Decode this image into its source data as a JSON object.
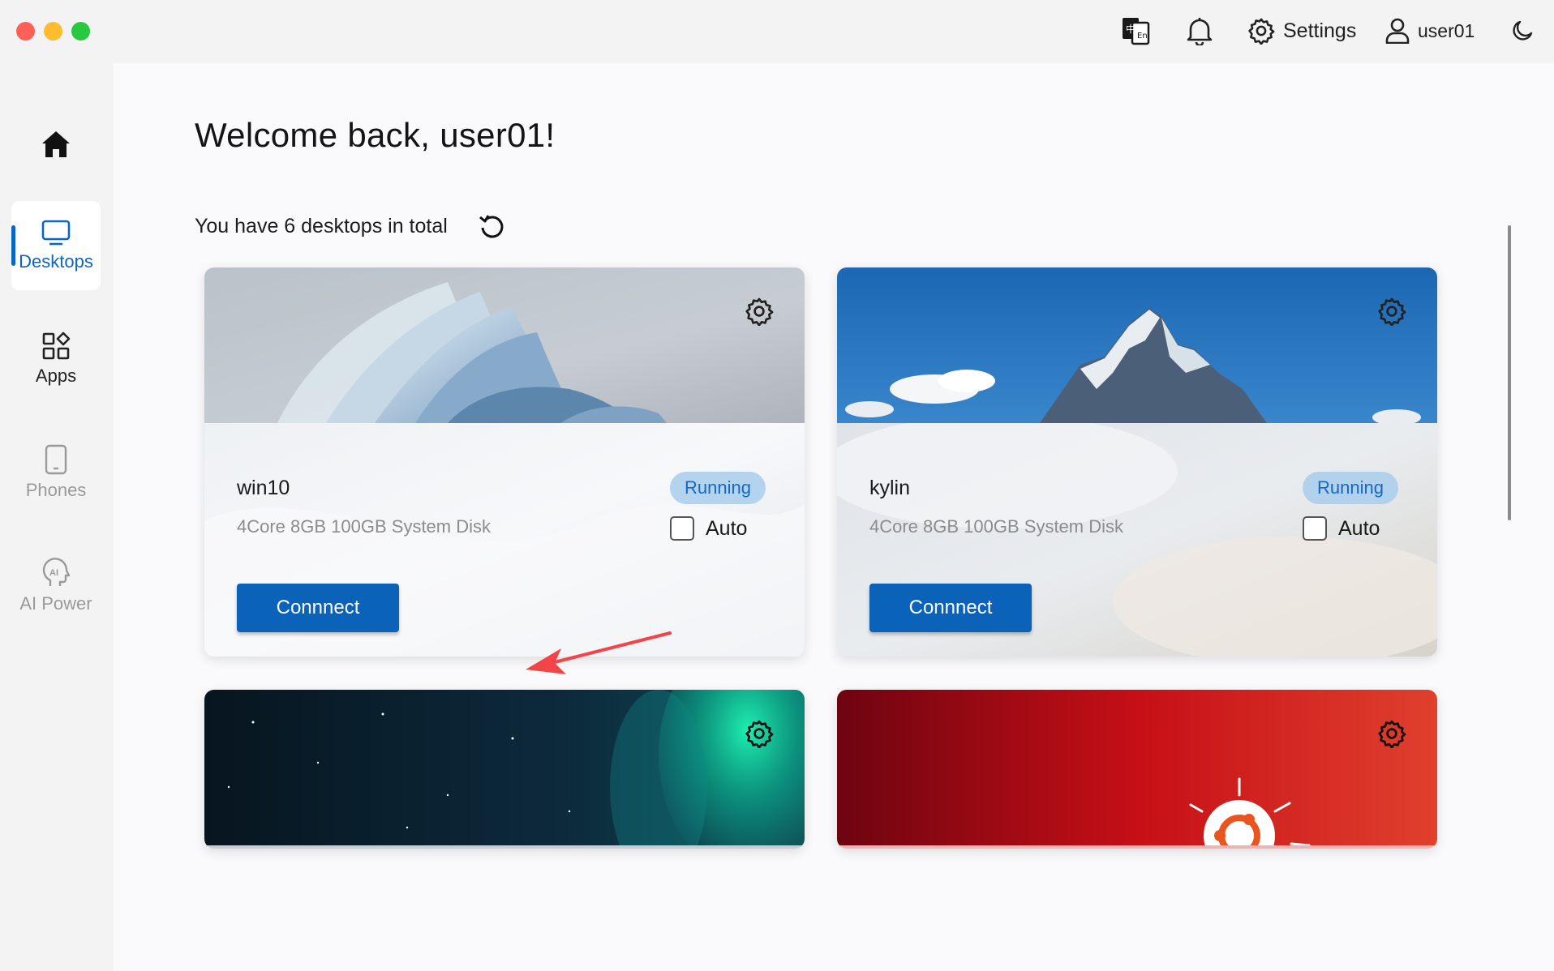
{
  "window": {
    "traffic_lights": [
      "#fe5f57",
      "#febc2e",
      "#28c840"
    ]
  },
  "header": {
    "language_icon": "translate-icon",
    "notification_icon": "bell-icon",
    "settings_label": "Settings",
    "user_label": "user01",
    "theme_icon": "moon-icon"
  },
  "sidebar": {
    "home_icon": "home-icon",
    "items": [
      {
        "label": "Desktops",
        "icon": "monitor-icon",
        "active": true
      },
      {
        "label": "Apps",
        "icon": "apps-grid-icon",
        "active": false
      },
      {
        "label": "Phones",
        "icon": "phone-icon",
        "active": false
      },
      {
        "label": "AI Power",
        "icon": "ai-head-icon",
        "active": false
      }
    ]
  },
  "main": {
    "welcome": "Welcome back, user01!",
    "summary": "You have 6 desktops in total",
    "accent_color": "#0a63b8",
    "desktops": [
      {
        "name": "win10",
        "spec": "4Core 8GB 100GB System Disk",
        "status": "Running",
        "auto_label": "Auto",
        "auto_checked": false,
        "connect_label": "Connnect"
      },
      {
        "name": "kylin",
        "spec": "4Core 8GB 100GB System Disk",
        "status": "Running",
        "auto_label": "Auto",
        "auto_checked": false,
        "connect_label": "Connnect"
      },
      {
        "name": "",
        "spec": "",
        "status": "",
        "connect_label": ""
      },
      {
        "name": "",
        "spec": "",
        "status": "",
        "connect_label": ""
      }
    ]
  }
}
